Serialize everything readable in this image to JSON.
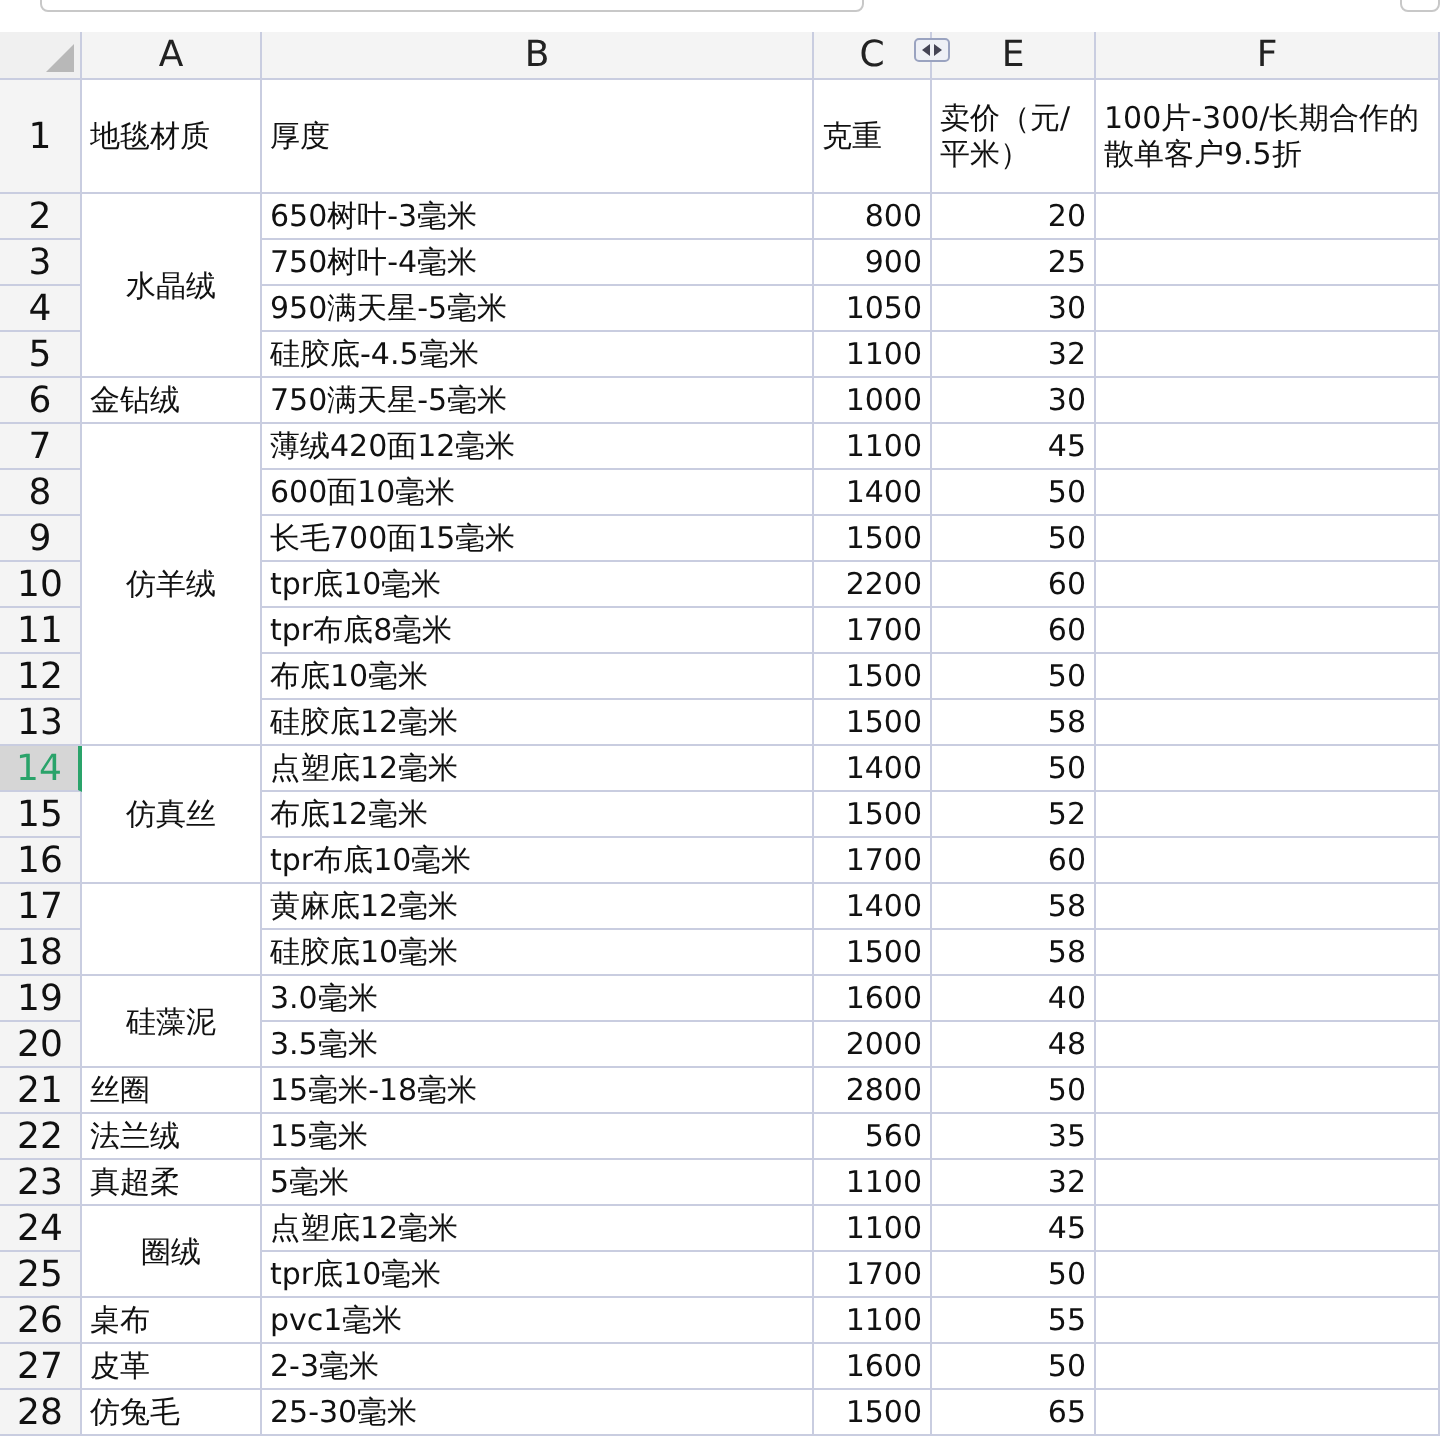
{
  "column_headers": [
    {
      "label": "A",
      "selected": false
    },
    {
      "label": "B",
      "selected": false
    },
    {
      "label": "C",
      "selected": false
    },
    {
      "label": "E",
      "selected": false
    },
    {
      "label": "F",
      "selected": false
    }
  ],
  "header_row": {
    "num": "1",
    "selected": false,
    "cells": [
      "地毯材质",
      "厚度",
      "克重",
      "卖价（元/平米）",
      "100片-300/长期合作的散单客户9.5折"
    ]
  },
  "groups": [
    {
      "material": "水晶绒",
      "rows": [
        {
          "num": "2",
          "selected": false,
          "thickness": "650树叶-3毫米",
          "weight": "800",
          "price": "20"
        },
        {
          "num": "3",
          "selected": false,
          "thickness": "750树叶-4毫米",
          "weight": "900",
          "price": "25"
        },
        {
          "num": "4",
          "selected": false,
          "thickness": "950满天星-5毫米",
          "weight": "1050",
          "price": "30"
        },
        {
          "num": "5",
          "selected": false,
          "thickness": "硅胶底-4.5毫米",
          "weight": "1100",
          "price": "32"
        }
      ]
    },
    {
      "material": "金钻绒",
      "rows": [
        {
          "num": "6",
          "selected": false,
          "thickness": "750满天星-5毫米",
          "weight": "1000",
          "price": "30"
        }
      ]
    },
    {
      "material": "仿羊绒",
      "rows": [
        {
          "num": "7",
          "selected": false,
          "thickness": "薄绒420面12毫米",
          "weight": "1100",
          "price": "45"
        },
        {
          "num": "8",
          "selected": false,
          "thickness": "600面10毫米",
          "weight": "1400",
          "price": "50"
        },
        {
          "num": "9",
          "selected": false,
          "thickness": "长毛700面15毫米",
          "weight": "1500",
          "price": "50"
        },
        {
          "num": "10",
          "selected": false,
          "thickness": "tpr底10毫米",
          "weight": "2200",
          "price": "60"
        },
        {
          "num": "11",
          "selected": false,
          "thickness": "tpr布底8毫米",
          "weight": "1700",
          "price": "60"
        },
        {
          "num": "12",
          "selected": false,
          "thickness": "布底10毫米",
          "weight": "1500",
          "price": "50"
        },
        {
          "num": "13",
          "selected": false,
          "thickness": "硅胶底12毫米",
          "weight": "1500",
          "price": "58"
        }
      ]
    },
    {
      "material": "仿真丝",
      "rows": [
        {
          "num": "14",
          "selected": true,
          "thickness": "点塑底12毫米",
          "weight": "1400",
          "price": "50"
        },
        {
          "num": "15",
          "selected": false,
          "thickness": "布底12毫米",
          "weight": "1500",
          "price": "52"
        },
        {
          "num": "16",
          "selected": false,
          "thickness": "tpr布底10毫米",
          "weight": "1700",
          "price": "60"
        }
      ]
    },
    {
      "rows": [
        {
          "num": "17",
          "selected": false,
          "thickness": "黄麻底12毫米",
          "weight": "1400",
          "price": "58"
        },
        {
          "num": "18",
          "selected": false,
          "thickness": "硅胶底10毫米",
          "weight": "1500",
          "price": "58"
        }
      ]
    },
    {
      "material": "硅藻泥",
      "rows": [
        {
          "num": "19",
          "selected": false,
          "thickness": "3.0毫米",
          "weight": "1600",
          "price": "40"
        },
        {
          "num": "20",
          "selected": false,
          "thickness": "3.5毫米",
          "weight": "2000",
          "price": "48"
        }
      ]
    },
    {
      "material": "丝圈",
      "rows": [
        {
          "num": "21",
          "selected": false,
          "thickness": "15毫米-18毫米",
          "weight": "2800",
          "price": "50"
        }
      ]
    },
    {
      "material": "法兰绒",
      "rows": [
        {
          "num": "22",
          "selected": false,
          "thickness": "15毫米",
          "weight": "560",
          "price": "35"
        }
      ]
    },
    {
      "material": "真超柔",
      "rows": [
        {
          "num": "23",
          "selected": false,
          "thickness": "5毫米",
          "weight": "1100",
          "price": "32"
        }
      ]
    },
    {
      "material": "圈绒",
      "rows": [
        {
          "num": "24",
          "selected": false,
          "thickness": "点塑底12毫米",
          "weight": "1100",
          "price": "45"
        },
        {
          "num": "25",
          "selected": false,
          "thickness": "tpr底10毫米",
          "weight": "1700",
          "price": "50"
        }
      ]
    },
    {
      "material": "桌布",
      "rows": [
        {
          "num": "26",
          "selected": false,
          "thickness": "pvc1毫米",
          "weight": "1100",
          "price": "55"
        }
      ]
    },
    {
      "material": "皮革",
      "rows": [
        {
          "num": "27",
          "selected": false,
          "thickness": "2-3毫米",
          "weight": "1600",
          "price": "50"
        }
      ]
    },
    {
      "material": "仿兔毛",
      "rows": [
        {
          "num": "28",
          "selected": false,
          "thickness": "25-30毫米",
          "weight": "1500",
          "price": "65"
        }
      ]
    }
  ]
}
